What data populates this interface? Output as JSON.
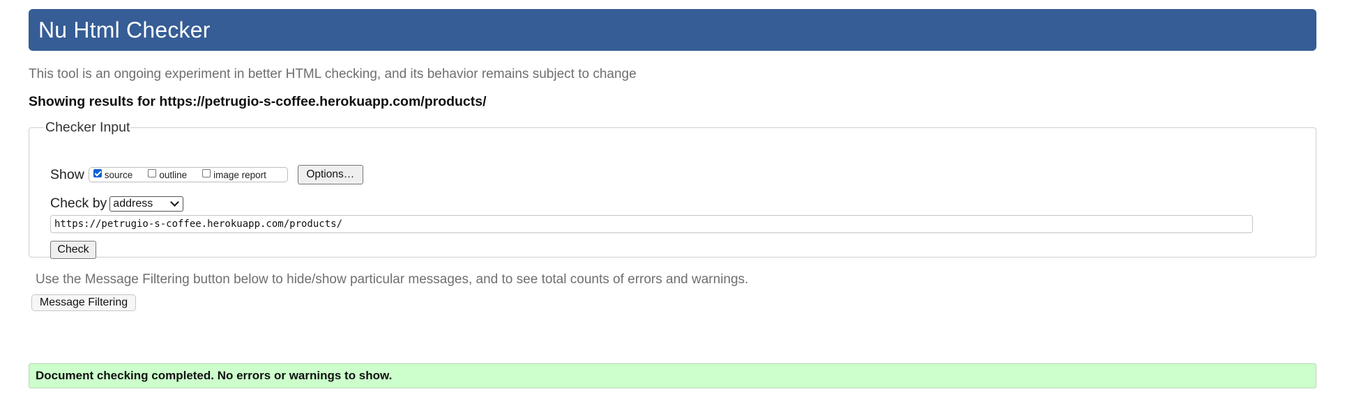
{
  "header": {
    "title": "Nu Html Checker"
  },
  "intro": {
    "text": "This tool is an ongoing experiment in better HTML checking, and its behavior remains subject to change"
  },
  "results": {
    "heading": "Showing results for https://petrugio-s-coffee.herokuapp.com/products/"
  },
  "checker_input": {
    "legend": "Checker Input",
    "show_label": "Show",
    "show_options": [
      {
        "label": "source",
        "checked": true
      },
      {
        "label": "outline",
        "checked": false
      },
      {
        "label": "image report",
        "checked": false
      }
    ],
    "options_button": "Options…",
    "check_by_label": "Check by",
    "check_by_value": "address",
    "url_value": "https://petrugio-s-coffee.herokuapp.com/products/",
    "check_button": "Check"
  },
  "filtering": {
    "note": "Use the Message Filtering button below to hide/show particular messages, and to see total counts of errors and warnings.",
    "button": "Message Filtering"
  },
  "status": {
    "message": "Document checking completed. No errors or warnings to show.",
    "color": "#ccffcc"
  },
  "colors": {
    "header_bg": "#365d95",
    "checkbox_checked": "#0b62d6"
  }
}
